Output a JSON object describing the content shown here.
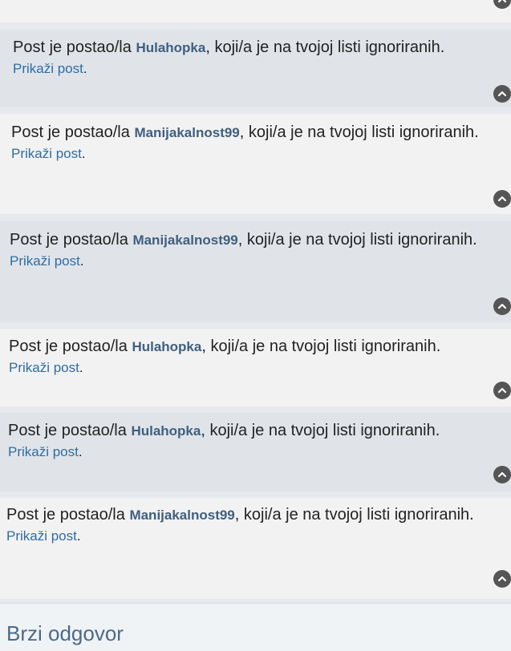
{
  "ignored_prefix": "Post je postao/la ",
  "ignored_suffix": ", koji/a je na tvojoj listi ignoriranih.",
  "show_post_label": "Prikaži post",
  "period": ".",
  "posts": [
    {
      "user": "Hulahopka"
    },
    {
      "user": "Manijakalnost99"
    },
    {
      "user": "Manijakalnost99"
    },
    {
      "user": "Hulahopka"
    },
    {
      "user": "Hulahopka"
    },
    {
      "user": "Manijakalnost99"
    }
  ],
  "quick_reply": {
    "title": "Brzi odgovor"
  },
  "icons": {
    "back_to_top": "chevron-up-icon"
  },
  "colors": {
    "username": "#3f5f80",
    "link": "#2e6da4",
    "heading": "#4c6a88"
  }
}
